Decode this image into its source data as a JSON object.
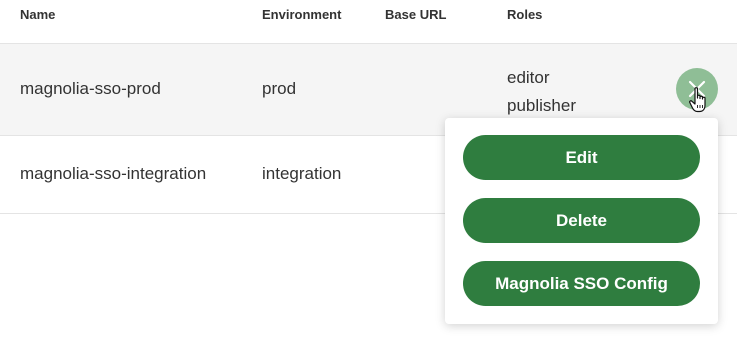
{
  "table": {
    "headers": {
      "name": "Name",
      "environment": "Environment",
      "base_url": "Base URL",
      "roles": "Roles"
    },
    "rows": [
      {
        "name": "magnolia-sso-prod",
        "environment": "prod",
        "base_url": "",
        "roles": [
          "editor",
          "publisher"
        ]
      },
      {
        "name": "magnolia-sso-integration",
        "environment": "integration",
        "base_url": "",
        "roles": []
      }
    ]
  },
  "row_menu": {
    "toggle_icon": "close-icon",
    "items": [
      {
        "label": "Edit"
      },
      {
        "label": "Delete"
      },
      {
        "label": "Magnolia SSO Config"
      }
    ]
  },
  "colors": {
    "primary_button": "#2f7d3f",
    "toggle_button": "#8fbe96",
    "selected_row": "#f5f5f5"
  }
}
